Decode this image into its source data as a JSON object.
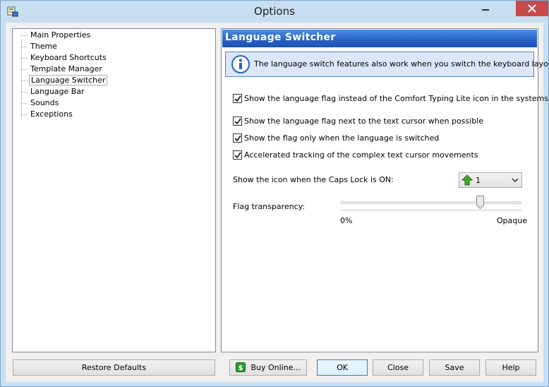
{
  "window": {
    "title": "Options"
  },
  "tree": {
    "items": [
      {
        "label": "Main Properties"
      },
      {
        "label": "Theme"
      },
      {
        "label": "Keyboard Shortcuts"
      },
      {
        "label": "Template Manager"
      },
      {
        "label": "Language Switcher",
        "selected": true
      },
      {
        "label": "Language Bar"
      },
      {
        "label": "Sounds"
      },
      {
        "label": "Exceptions"
      }
    ]
  },
  "panel": {
    "header": "Language Switcher",
    "info": "The language switch features also work when you switch the keyboard layout.",
    "options": [
      {
        "label": "Show the language flag instead of the Comfort Typing Lite icon in the systems tray",
        "checked": true
      },
      {
        "label": "Show the language flag next to the text cursor when possible",
        "checked": true
      },
      {
        "label": "Show the flag only when the language is switched",
        "checked": true
      },
      {
        "label": "Accelerated tracking of the complex text cursor movements",
        "checked": true
      }
    ],
    "caps_lock": {
      "label": "Show the icon when the Caps Lock is ON:",
      "value": "1"
    },
    "transparency": {
      "label": "Flag transparency:",
      "min_label": "0%",
      "max_label": "Opaque",
      "value_percent": 77
    }
  },
  "buttons": {
    "restore": "Restore Defaults",
    "buy": "Buy Online...",
    "ok": "OK",
    "close": "Close",
    "save": "Save",
    "help": "Help"
  },
  "colors": {
    "header_blue": "#2a63c6",
    "info_bg": "#dbe7f8",
    "close_red": "#c74a4a"
  }
}
